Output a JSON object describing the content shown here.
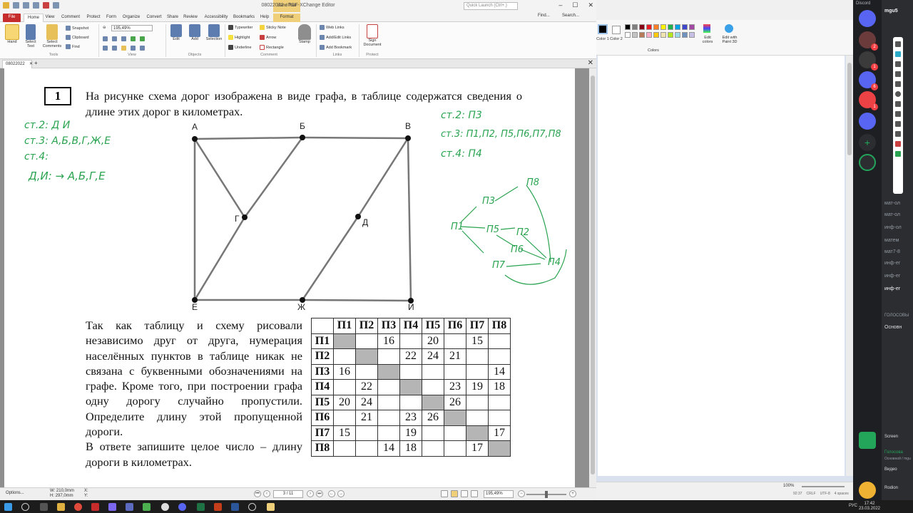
{
  "pdf_window": {
    "title": "08022022 - PDF-XChange Editor",
    "context_tab_header": "Hand Tool",
    "quick_launch_placeholder": "Quick Launch (Ctrl+.)",
    "ribbon_tabs": [
      "File",
      "Home",
      "View",
      "Comment",
      "Protect",
      "Form",
      "Organize",
      "Convert",
      "Share",
      "Review",
      "Accessibility",
      "Bookmarks",
      "Help",
      "Format"
    ],
    "find_label": "Find...",
    "search_label": "Search...",
    "tools": {
      "hand": "Hand",
      "select_text": "Select Text",
      "select_comments": "Select Comments",
      "snapshot": "Snapshot",
      "clipboard": "Clipboard",
      "find": "Find",
      "zoom_value": "195,49%",
      "edit": "Edit",
      "add": "Add",
      "selection": "Selection",
      "typewriter": "Typewriter",
      "sticky_note": "Sticky Note",
      "highlight": "Highlight",
      "arrow": "Arrow",
      "underline": "Underline",
      "rectangle": "Rectangle",
      "stamp": "Stamp",
      "web_links": "Web Links",
      "add_edit_links": "Add/Edit Links",
      "add_bookmark": "Add Bookmark",
      "sign_document": "Sign Document"
    },
    "group_labels": [
      "Tools",
      "View",
      "Objects",
      "Comment",
      "Links",
      "Protect"
    ],
    "doc_tab": "08022022",
    "status": {
      "options": "Options...",
      "width": "W: 210,0mm",
      "height": "H: 297,0mm",
      "x": "X:",
      "y": "Y:",
      "page": "3 / 11",
      "zoom": "195,49%"
    }
  },
  "problem": {
    "number": "1",
    "intro": "На рисунке схема дорог изображена в виде графа, в таблице содержатся сведения о длине этих дорог в километрах.",
    "body_1": "Так как таблицу и схему рисовали независимо друг от друга, нумерация населённых пунктов в таблице никак не связана с буквенными обозначениями на графе. Кроме того, при построении графа одну дорогу случайно пропустили. Определите длину этой пропущенной дороги.",
    "body_2": "В ответе запишите целое число – длину дороги в километрах."
  },
  "graph": {
    "nodes": [
      "А",
      "Б",
      "В",
      "Г",
      "Д",
      "Е",
      "Ж",
      "И"
    ]
  },
  "table": {
    "headers": [
      "П1",
      "П2",
      "П3",
      "П4",
      "П5",
      "П6",
      "П7",
      "П8"
    ],
    "rows": [
      {
        "label": "П1",
        "cells": [
          "",
          "",
          "16",
          "",
          "20",
          "",
          "15",
          ""
        ]
      },
      {
        "label": "П2",
        "cells": [
          "",
          "",
          "",
          "22",
          "24",
          "21",
          "",
          ""
        ]
      },
      {
        "label": "П3",
        "cells": [
          "16",
          "",
          "",
          "",
          "",
          "",
          "",
          "14"
        ]
      },
      {
        "label": "П4",
        "cells": [
          "",
          "22",
          "",
          "",
          "",
          "23",
          "19",
          "18"
        ]
      },
      {
        "label": "П5",
        "cells": [
          "20",
          "24",
          "",
          "",
          "",
          "26",
          "",
          ""
        ]
      },
      {
        "label": "П6",
        "cells": [
          "",
          "21",
          "",
          "23",
          "26",
          "",
          "",
          ""
        ]
      },
      {
        "label": "П7",
        "cells": [
          "15",
          "",
          "",
          "19",
          "",
          "",
          "",
          "17"
        ]
      },
      {
        "label": "П8",
        "cells": [
          "",
          "",
          "14",
          "18",
          "",
          "",
          "17",
          ""
        ]
      }
    ]
  },
  "notes_left": [
    "ст.2: Д И",
    "ст.3: А,Б,В,Г,Ж,Е",
    "ст.4:",
    "Д,И: → А,Б,Г,Е"
  ],
  "notes_right": [
    "ст.2: П3",
    "ст.3: П1,П2, П5,П6,П7,П8",
    "ст.4: П4"
  ],
  "note_graph_labels": [
    "П8",
    "П3",
    "П1",
    "П5",
    "П2",
    "П6",
    "П7",
    "П4"
  ],
  "paint": {
    "color1": "Color 1",
    "color2": "Color 2",
    "edit_colors": "Edit colors",
    "edit_paint3d": "Edit with Paint 3D",
    "colors_group": "Colors",
    "palette": [
      "#000000",
      "#7f7f7f",
      "#880015",
      "#ed1c24",
      "#ff7f27",
      "#fff200",
      "#22b14c",
      "#00a2e8",
      "#3f48cc",
      "#a349a4",
      "#ffffff",
      "#c3c3c3",
      "#b97a57",
      "#ffaec9",
      "#ffc90e",
      "#efe4b0",
      "#b5e61d",
      "#99d9ea",
      "#7092be",
      "#c8bfe7"
    ],
    "zoom": "100%",
    "status_items": [
      "92:37",
      "CRLF",
      "UTF-8",
      "4 spaces"
    ]
  },
  "discord": {
    "app_label": "Discord",
    "server_name": "mgu5",
    "channels": [
      "мат-ол",
      "мат-ол",
      "инф-ол",
      "матем",
      "мат7-8",
      "инф-ег",
      "инф-ег",
      "инф-ег"
    ],
    "voice_header": "ГОЛОСОВЫ",
    "voice_channel": "Основн",
    "screen_label": "Screen",
    "voice_status": "Голосова",
    "voice_sub": "Основной / mgu",
    "video_label": "Видео",
    "user": "Rodion"
  },
  "taskbar": {
    "lang": "РУС",
    "time": "17:42",
    "date": "23.03.2022"
  },
  "colors": {
    "file_tab": "#c62c2c",
    "format_tab": "#f0cf7a",
    "handwriting": "#2aa350",
    "discord_bg": "#2b2d31"
  }
}
